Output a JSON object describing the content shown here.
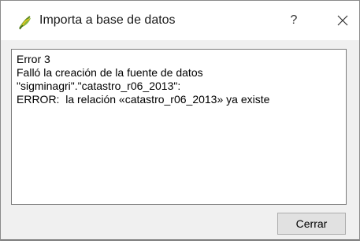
{
  "window": {
    "title": "Importa a base de datos",
    "help_label": "?",
    "app_icon": "qgis-logo-icon",
    "close_icon": "close-icon"
  },
  "message": {
    "lines": [
      "Error 3",
      "Falló la creación de la fuente de datos",
      "\"sigminagri\".\"catastro_r06_2013\":",
      "ERROR:  la relación «catastro_r06_2013» ya existe"
    ]
  },
  "buttons": {
    "close_label": "Cerrar"
  },
  "colors": {
    "client_background": "#f0f0f0",
    "button_background": "#e1e1e1",
    "icon_green": "#8bb73b",
    "icon_yellow": "#f0c419"
  }
}
